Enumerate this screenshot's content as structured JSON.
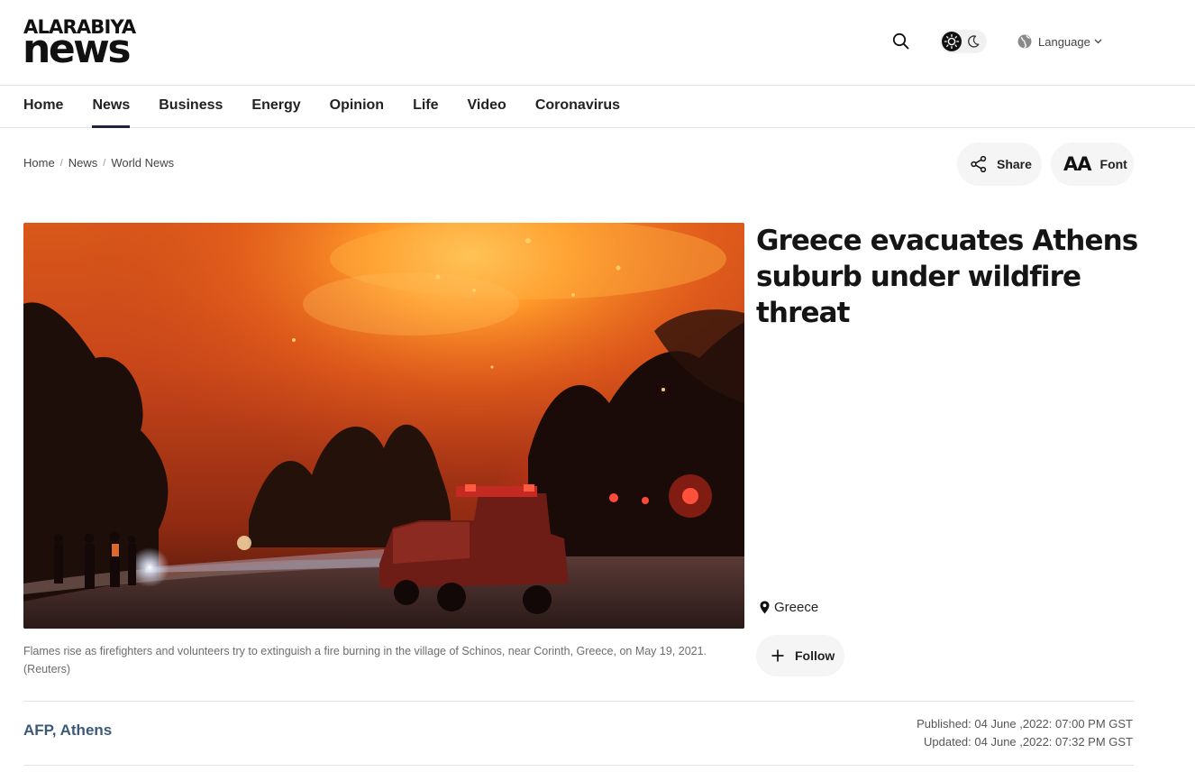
{
  "logo": {
    "top": "ALARABIYA",
    "bottom": "news"
  },
  "header": {
    "search_icon": "search-icon",
    "theme_icons": [
      "sun-icon",
      "moon-icon"
    ],
    "language_label": "Language"
  },
  "nav": {
    "items": [
      {
        "label": "Home"
      },
      {
        "label": "News",
        "active": true
      },
      {
        "label": "Business"
      },
      {
        "label": "Energy"
      },
      {
        "label": "Opinion"
      },
      {
        "label": "Life"
      },
      {
        "label": "Video"
      },
      {
        "label": "Coronavirus"
      }
    ]
  },
  "breadcrumb": [
    "Home",
    "News",
    "World News"
  ],
  "actions": {
    "share_label": "Share",
    "font_icon": "AA",
    "font_label": "Font"
  },
  "article": {
    "headline": "Greece evacuates Athens suburb under wildfire threat",
    "caption": "Flames rise as firefighters and volunteers try to extinguish a fire burning in the village of Schinos, near Corinth, Greece, on May 19, 2021. (Reuters)",
    "location": "Greece",
    "follow_label": "Follow",
    "byline": "AFP, Athens",
    "published": "Published: 04 June ,2022: 07:00 PM GST",
    "updated": "Updated: 04 June ,2022: 07:32 PM GST"
  },
  "colors": {
    "accent": "#1e2140",
    "byline": "#3c5a78",
    "pill_bg": "#f5f5f6"
  }
}
